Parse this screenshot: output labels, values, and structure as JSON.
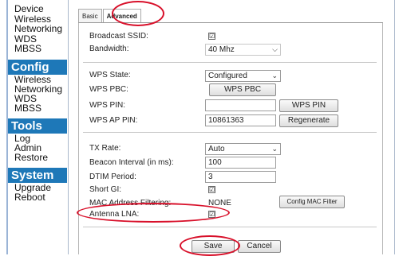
{
  "sidebar": {
    "group0_items": [
      "Device",
      "Wireless",
      "Networking",
      "WDS",
      "MBSS"
    ],
    "config": {
      "title": "Config",
      "items": [
        "Wireless",
        "Networking",
        "WDS",
        "MBSS"
      ]
    },
    "tools": {
      "title": "Tools",
      "items": [
        "Log",
        "Admin",
        "Restore"
      ]
    },
    "system": {
      "title": "System",
      "items": [
        "Upgrade",
        "Reboot"
      ]
    }
  },
  "tabs": [
    {
      "label": "Basic",
      "active": false
    },
    {
      "label": "Advanced",
      "active": true
    }
  ],
  "form": {
    "broadcast_ssid": {
      "label": "Broadcast SSID:",
      "checked": true
    },
    "bandwidth": {
      "label": "Bandwidth:",
      "value": "40 Mhz"
    },
    "wps_state": {
      "label": "WPS State:",
      "value": "Configured"
    },
    "wps_pbc": {
      "label": "WPS PBC:",
      "button": "WPS PBC"
    },
    "wps_pin": {
      "label": "WPS PIN:",
      "value": "",
      "button": "WPS PIN"
    },
    "wps_ap_pin": {
      "label": "WPS AP PIN:",
      "value": "10861363",
      "button": "Regenerate"
    },
    "tx_rate": {
      "label": "TX Rate:",
      "value": "Auto"
    },
    "beacon_interval": {
      "label": "Beacon Interval (in ms):",
      "value": "100"
    },
    "dtim_period": {
      "label": "DTIM Period:",
      "value": "3"
    },
    "short_gi": {
      "label": "Short GI:",
      "checked": true
    },
    "mac_filtering": {
      "label": "MAC Address Filtering:",
      "value": "NONE",
      "button": "Config MAC Filter"
    },
    "antenna_lna": {
      "label": "Antenna LNA:",
      "checked": true
    }
  },
  "actions": {
    "save": "Save",
    "cancel": "Cancel"
  },
  "check_glyph": "☑",
  "colors": {
    "sidebar_header": "#1e78b8",
    "annotation": "#d8102a"
  }
}
